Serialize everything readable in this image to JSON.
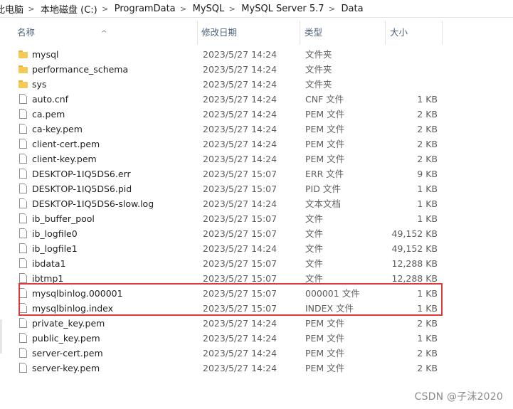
{
  "breadcrumb": [
    "此电脑",
    "本地磁盘 (C:)",
    "ProgramData",
    "MySQL",
    "MySQL Server 5.7",
    "Data"
  ],
  "breadcrumb_separator": ">",
  "columns": {
    "name": "名称",
    "date": "修改日期",
    "type": "类型",
    "size": "大小"
  },
  "sort_indicator": "^",
  "files": [
    {
      "name": "mysql",
      "date": "2023/5/27 14:24",
      "type": "文件夹",
      "size": "",
      "kind": "folder-icon"
    },
    {
      "name": "performance_schema",
      "date": "2023/5/27 14:24",
      "type": "文件夹",
      "size": "",
      "kind": "folder-icon"
    },
    {
      "name": "sys",
      "date": "2023/5/27 14:24",
      "type": "文件夹",
      "size": "",
      "kind": "folder-icon"
    },
    {
      "name": "auto.cnf",
      "date": "2023/5/27 14:24",
      "type": "CNF 文件",
      "size": "1 KB",
      "kind": "file-icon"
    },
    {
      "name": "ca.pem",
      "date": "2023/5/27 14:24",
      "type": "PEM 文件",
      "size": "2 KB",
      "kind": "file-icon"
    },
    {
      "name": "ca-key.pem",
      "date": "2023/5/27 14:24",
      "type": "PEM 文件",
      "size": "2 KB",
      "kind": "file-icon"
    },
    {
      "name": "client-cert.pem",
      "date": "2023/5/27 14:24",
      "type": "PEM 文件",
      "size": "2 KB",
      "kind": "file-icon"
    },
    {
      "name": "client-key.pem",
      "date": "2023/5/27 14:24",
      "type": "PEM 文件",
      "size": "2 KB",
      "kind": "file-icon"
    },
    {
      "name": "DESKTOP-1IQ5DS6.err",
      "date": "2023/5/27 15:07",
      "type": "ERR 文件",
      "size": "9 KB",
      "kind": "file-icon"
    },
    {
      "name": "DESKTOP-1IQ5DS6.pid",
      "date": "2023/5/27 15:07",
      "type": "PID 文件",
      "size": "1 KB",
      "kind": "file-icon"
    },
    {
      "name": "DESKTOP-1IQ5DS6-slow.log",
      "date": "2023/5/27 14:24",
      "type": "文本文档",
      "size": "1 KB",
      "kind": "file-icon"
    },
    {
      "name": "ib_buffer_pool",
      "date": "2023/5/27 15:07",
      "type": "文件",
      "size": "1 KB",
      "kind": "file-icon"
    },
    {
      "name": "ib_logfile0",
      "date": "2023/5/27 15:07",
      "type": "文件",
      "size": "49,152 KB",
      "kind": "file-icon"
    },
    {
      "name": "ib_logfile1",
      "date": "2023/5/27 14:24",
      "type": "文件",
      "size": "49,152 KB",
      "kind": "file-icon"
    },
    {
      "name": "ibdata1",
      "date": "2023/5/27 15:07",
      "type": "文件",
      "size": "12,288 KB",
      "kind": "file-icon"
    },
    {
      "name": "ibtmp1",
      "date": "2023/5/27 15:07",
      "type": "文件",
      "size": "12,288 KB",
      "kind": "file-icon"
    },
    {
      "name": "mysqlbinlog.000001",
      "date": "2023/5/27 15:07",
      "type": "000001 文件",
      "size": "1 KB",
      "kind": "file-icon"
    },
    {
      "name": "mysqlbinlog.index",
      "date": "2023/5/27 15:07",
      "type": "INDEX 文件",
      "size": "1 KB",
      "kind": "file-icon"
    },
    {
      "name": "private_key.pem",
      "date": "2023/5/27 14:24",
      "type": "PEM 文件",
      "size": "2 KB",
      "kind": "file-icon"
    },
    {
      "name": "public_key.pem",
      "date": "2023/5/27 14:24",
      "type": "PEM 文件",
      "size": "1 KB",
      "kind": "file-icon"
    },
    {
      "name": "server-cert.pem",
      "date": "2023/5/27 14:24",
      "type": "PEM 文件",
      "size": "2 KB",
      "kind": "file-icon"
    },
    {
      "name": "server-key.pem",
      "date": "2023/5/27 14:24",
      "type": "PEM 文件",
      "size": "2 KB",
      "kind": "file-icon"
    }
  ],
  "highlight_color": "#e0383b",
  "watermark": "CSDN @子沫2020"
}
